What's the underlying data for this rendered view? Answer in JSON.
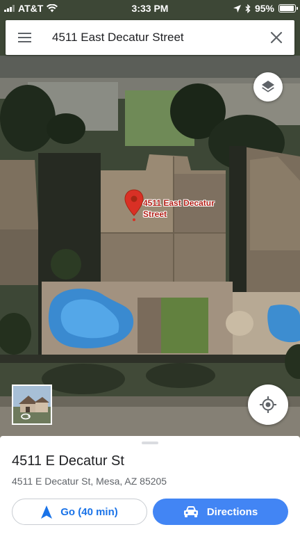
{
  "status_bar": {
    "carrier": "AT&T",
    "time": "3:33 PM",
    "battery_percent": "95%",
    "battery_level": 0.95
  },
  "search": {
    "query": "4511 East Decatur Street"
  },
  "map": {
    "pin_label_line1": "4511 East Decatur",
    "pin_label_line2": "Street",
    "pin_color": "#d93025",
    "imagery": "satellite"
  },
  "place": {
    "name": "4511 E Decatur St",
    "address": "4511 E Decatur St, Mesa, AZ 85205"
  },
  "actions": {
    "go_label": "Go (40 min)",
    "directions_label": "Directions",
    "accent": "#4285f4"
  },
  "icons": {
    "menu": "menu-icon",
    "close": "close-icon",
    "layers": "layers-icon",
    "my_location": "my-location-icon",
    "navigate": "navigation-arrow-icon",
    "car": "car-icon"
  }
}
